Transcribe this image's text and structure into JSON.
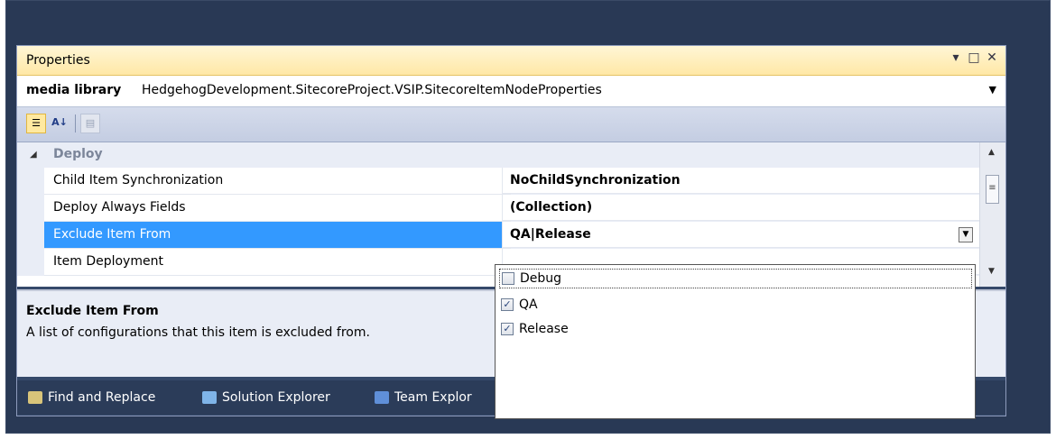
{
  "panel": {
    "title": "Properties"
  },
  "object_selector": {
    "name": "media library",
    "type": "HedgehogDevelopment.SitecoreProject.VSIP.SitecoreItemNodeProperties"
  },
  "toolbar": {
    "categorized_icon": "categorized-icon",
    "alphabetical_icon": "alphabetical-icon",
    "property_pages_icon": "property-pages-icon"
  },
  "grid": {
    "category": "Deploy",
    "rows": [
      {
        "name": "Child Item Synchronization",
        "value": "NoChildSynchronization"
      },
      {
        "name": "Deploy Always Fields",
        "value": "(Collection)"
      },
      {
        "name": "Exclude Item From",
        "value": "QA|Release"
      },
      {
        "name": "Item Deployment",
        "value": ""
      }
    ]
  },
  "description": {
    "title": "Exclude Item From",
    "text": "A list of configurations that this item is excluded from."
  },
  "dropdown": {
    "options": [
      {
        "label": "Debug",
        "checked": false
      },
      {
        "label": "QA",
        "checked": true
      },
      {
        "label": "Release",
        "checked": true
      }
    ]
  },
  "bottom_tabs": [
    {
      "label": "Find and Replace"
    },
    {
      "label": "Solution Explorer"
    },
    {
      "label": "Team Explor"
    }
  ],
  "colors": {
    "selection": "#3399ff",
    "title_gradient_top": "#fff6d6",
    "frame": "#293955"
  }
}
